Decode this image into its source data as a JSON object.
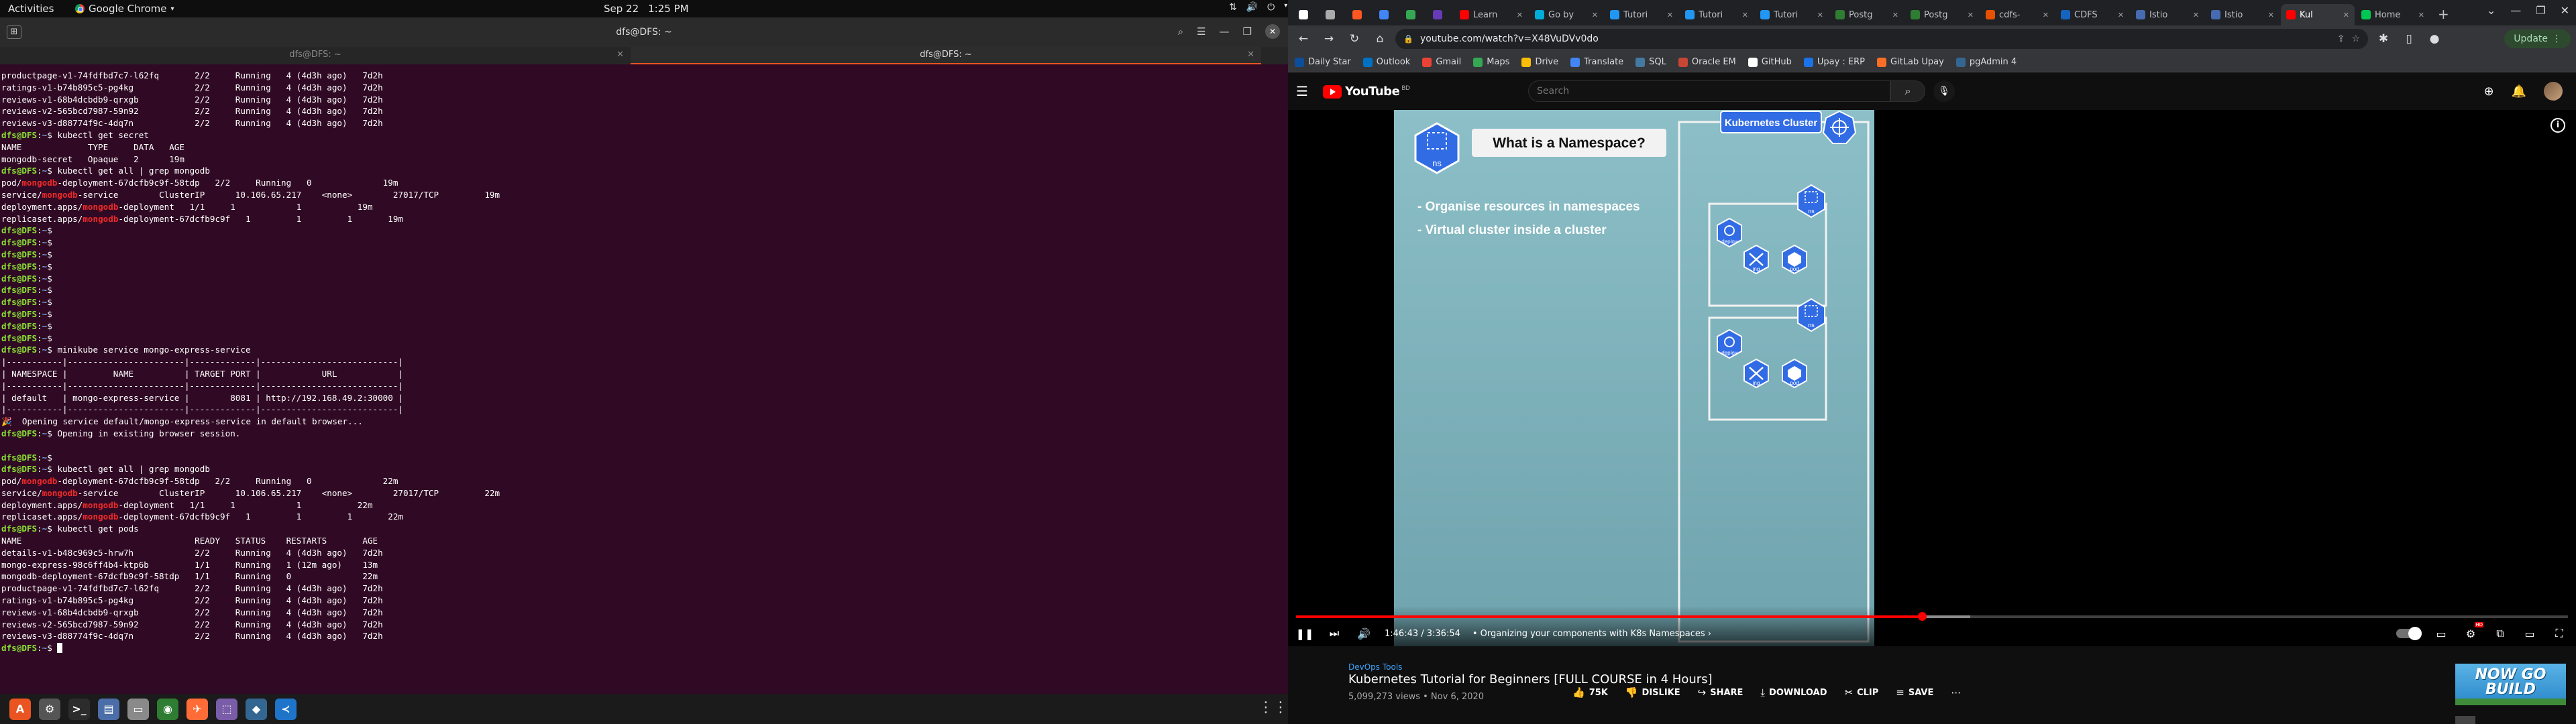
{
  "topbar": {
    "activities": "Activities",
    "app_name": "Google Chrome",
    "date": "Sep 22",
    "time": "1:25 PM"
  },
  "terminal": {
    "title": "dfs@DFS: ~",
    "tabs": [
      {
        "label": "dfs@DFS: ~",
        "active": false
      },
      {
        "label": "dfs@DFS: ~",
        "active": true
      }
    ],
    "prompt_user": "dfs@DFS",
    "prompt_path": "~",
    "lines": [
      {
        "t": "out",
        "text": "productpage-v1-74fdfbd7c7-l62fq       2/2     Running   4 (4d3h ago)   7d2h"
      },
      {
        "t": "out",
        "text": "ratings-v1-b74b895c5-pg4kg            2/2     Running   4 (4d3h ago)   7d2h"
      },
      {
        "t": "out",
        "text": "reviews-v1-68b4dcbdb9-qrxgb           2/2     Running   4 (4d3h ago)   7d2h"
      },
      {
        "t": "out",
        "text": "reviews-v2-565bcd7987-59n92           2/2     Running   4 (4d3h ago)   7d2h"
      },
      {
        "t": "out",
        "text": "reviews-v3-d88774f9c-4dq7n            2/2     Running   4 (4d3h ago)   7d2h"
      },
      {
        "t": "cmd",
        "text": "kubectl get secret"
      },
      {
        "t": "out",
        "text": "NAME             TYPE     DATA   AGE"
      },
      {
        "t": "out",
        "text": "mongodb-secret   Opaque   2      19m"
      },
      {
        "t": "cmd",
        "text": "kubectl get all | grep mongodb"
      },
      {
        "t": "hl",
        "pre": "pod/",
        "mid": "mongodb",
        "post": "-deployment-67dcfb9c9f-58tdp   2/2     Running   0              19m"
      },
      {
        "t": "hl",
        "pre": "service/",
        "mid": "mongodb",
        "post": "-service        ClusterIP      10.106.65.217    <none>        27017/TCP         19m"
      },
      {
        "t": "hl",
        "pre": "deployment.apps/",
        "mid": "mongodb",
        "post": "-deployment   1/1     1            1           19m"
      },
      {
        "t": "hl",
        "pre": "replicaset.apps/",
        "mid": "mongodb",
        "post": "-deployment-67dcfb9c9f   1         1         1       19m"
      },
      {
        "t": "cmd",
        "text": ""
      },
      {
        "t": "cmd",
        "text": ""
      },
      {
        "t": "cmd",
        "text": ""
      },
      {
        "t": "cmd",
        "text": ""
      },
      {
        "t": "cmd",
        "text": ""
      },
      {
        "t": "cmd",
        "text": ""
      },
      {
        "t": "cmd",
        "text": ""
      },
      {
        "t": "cmd",
        "text": ""
      },
      {
        "t": "cmd",
        "text": ""
      },
      {
        "t": "cmd",
        "text": ""
      },
      {
        "t": "cmd",
        "text": "minikube service mongo-express-service"
      },
      {
        "t": "out",
        "text": "|-----------|-----------------------|-------------|---------------------------|"
      },
      {
        "t": "out",
        "text": "| NAMESPACE |         NAME          | TARGET PORT |            URL            |"
      },
      {
        "t": "out",
        "text": "|-----------|-----------------------|-------------|---------------------------|"
      },
      {
        "t": "out",
        "text": "| default   | mongo-express-service |        8081 | http://192.168.49.2:30000 |"
      },
      {
        "t": "out",
        "text": "|-----------|-----------------------|-------------|---------------------------|"
      },
      {
        "t": "out",
        "text": "🎉  Opening service default/mongo-express-service in default browser..."
      },
      {
        "t": "cmd",
        "text": "Opening in existing browser session."
      },
      {
        "t": "out",
        "text": ""
      },
      {
        "t": "cmd",
        "text": ""
      },
      {
        "t": "cmd",
        "text": "kubectl get all | grep mongodb"
      },
      {
        "t": "hl",
        "pre": "pod/",
        "mid": "mongodb",
        "post": "-deployment-67dcfb9c9f-58tdp   2/2     Running   0              22m"
      },
      {
        "t": "hl",
        "pre": "service/",
        "mid": "mongodb",
        "post": "-service        ClusterIP      10.106.65.217    <none>        27017/TCP         22m"
      },
      {
        "t": "hl",
        "pre": "deployment.apps/",
        "mid": "mongodb",
        "post": "-deployment   1/1     1            1           22m"
      },
      {
        "t": "hl",
        "pre": "replicaset.apps/",
        "mid": "mongodb",
        "post": "-deployment-67dcfb9c9f   1         1         1       22m"
      },
      {
        "t": "cmd",
        "text": "kubectl get pods"
      },
      {
        "t": "out",
        "text": "NAME                                  READY   STATUS    RESTARTS       AGE"
      },
      {
        "t": "out",
        "text": "details-v1-b48c969c5-hrw7h            2/2     Running   4 (4d3h ago)   7d2h"
      },
      {
        "t": "out",
        "text": "mongo-express-98c6ff4b4-ktp6b         1/1     Running   1 (12m ago)    13m"
      },
      {
        "t": "out",
        "text": "mongodb-deployment-67dcfb9c9f-58tdp   1/1     Running   0              22m"
      },
      {
        "t": "out",
        "text": "productpage-v1-74fdfbd7c7-l62fq       2/2     Running   4 (4d3h ago)   7d2h"
      },
      {
        "t": "out",
        "text": "ratings-v1-b74b895c5-pg4kg            2/2     Running   4 (4d3h ago)   7d2h"
      },
      {
        "t": "out",
        "text": "reviews-v1-68b4dcbdb9-qrxgb           2/2     Running   4 (4d3h ago)   7d2h"
      },
      {
        "t": "out",
        "text": "reviews-v2-565bcd7987-59n92           2/2     Running   4 (4d3h ago)   7d2h"
      },
      {
        "t": "out",
        "text": "reviews-v3-d88774f9c-4dq7n            2/2     Running   4 (4d3h ago)   7d2h"
      },
      {
        "t": "cursor",
        "text": ""
      }
    ]
  },
  "dock": {
    "apps": [
      {
        "name": "ubuntu-software-icon",
        "glyph": "A",
        "color": "#e95420"
      },
      {
        "name": "settings-icon",
        "glyph": "⚙",
        "color": "#555555"
      },
      {
        "name": "terminal-icon",
        "glyph": ">_",
        "color": "#2c2c2c"
      },
      {
        "name": "files-icon",
        "glyph": "▤",
        "color": "#4c6ea8"
      },
      {
        "name": "folder-icon",
        "glyph": "▭",
        "color": "#8a8a8a"
      },
      {
        "name": "chrome-icon",
        "glyph": "◉",
        "color": "#2f7d32"
      },
      {
        "name": "postman-icon",
        "glyph": "✈",
        "color": "#ff6c37"
      },
      {
        "name": "screenshot-icon",
        "glyph": "⬚",
        "color": "#7a5da8"
      },
      {
        "name": "pgadmin-icon",
        "glyph": "◆",
        "color": "#336791"
      },
      {
        "name": "vscode-icon",
        "glyph": "≺",
        "color": "#1e74c9"
      }
    ],
    "apps_grid_glyph": "⋮⋮⋮"
  },
  "chrome": {
    "tabs": [
      {
        "label": "",
        "color": "#ffffff"
      },
      {
        "label": "",
        "color": "#aaaaaa"
      },
      {
        "label": "",
        "color": "#ff5722"
      },
      {
        "label": "",
        "color": "#4285f4"
      },
      {
        "label": "",
        "color": "#34a853"
      },
      {
        "label": "",
        "color": "#673ab7"
      },
      {
        "label": "Learn",
        "color": "#ff0000"
      },
      {
        "label": "Go by",
        "color": "#00add8"
      },
      {
        "label": "Tutori",
        "color": "#2196f3"
      },
      {
        "label": "Tutori",
        "color": "#2196f3"
      },
      {
        "label": "Tutori",
        "color": "#2196f3"
      },
      {
        "label": "Postg",
        "color": "#2e7d32"
      },
      {
        "label": "Postg",
        "color": "#2e7d32"
      },
      {
        "label": "cdfs-",
        "color": "#e65100"
      },
      {
        "label": "CDFS",
        "color": "#1565c0"
      },
      {
        "label": "Istio",
        "color": "#466bb0"
      },
      {
        "label": "Istio",
        "color": "#466bb0"
      },
      {
        "label": "Kul",
        "color": "#ff0000",
        "active": true
      },
      {
        "label": "Home",
        "color": "#00c853"
      }
    ],
    "new_tab": "+",
    "url": "youtube.com/watch?v=X48VuDVv0do",
    "update_label": "Update",
    "bookmarks": [
      {
        "label": "Daily Star",
        "color": "#0b4f9c"
      },
      {
        "label": "Outlook",
        "color": "#0072c6"
      },
      {
        "label": "Gmail",
        "color": "#ea4335"
      },
      {
        "label": "Maps",
        "color": "#34a853"
      },
      {
        "label": "Drive",
        "color": "#fbbc05"
      },
      {
        "label": "Translate",
        "color": "#4285f4"
      },
      {
        "label": "SQL",
        "color": "#4479a1"
      },
      {
        "label": "Oracle EM",
        "color": "#c74634"
      },
      {
        "label": "GitHub",
        "color": "#ffffff"
      },
      {
        "label": "Upay : ERP",
        "color": "#1a73e8"
      },
      {
        "label": "GitLab Upay",
        "color": "#fc6d26"
      },
      {
        "label": "pgAdmin 4",
        "color": "#336791"
      }
    ]
  },
  "youtube": {
    "logo_text": "YouTube",
    "region": "BD",
    "search_placeholder": "Search",
    "slide": {
      "title": "What is a Namespace?",
      "cluster_label": "Kubernetes Cluster",
      "bullets": [
        "- Organise resources in namespaces",
        "- Virtual cluster inside a cluster"
      ],
      "ns_label": "ns",
      "deploy_label": "deploy",
      "svc_label": "svc",
      "ing_label": "ing",
      "pod_label": "pod"
    },
    "player": {
      "time": "1:46:43 / 3:36:54",
      "chapter": "• Organizing your components with K8s Namespaces",
      "played_pct": 49.2,
      "buffer_pct": 53
    },
    "video": {
      "channel": "DevOps Tools",
      "title": "Kubernetes Tutorial for Beginners [FULL COURSE in 4 Hours]",
      "meta": "5,099,273 views • Nov 6, 2020",
      "likes": "75K",
      "dislike": "DISLIKE",
      "share": "SHARE",
      "download": "DOWNLOAD",
      "clip": "CLIP",
      "save": "SAVE"
    },
    "ad": {
      "line1": "NOW GO",
      "line2": "BUILD"
    }
  }
}
